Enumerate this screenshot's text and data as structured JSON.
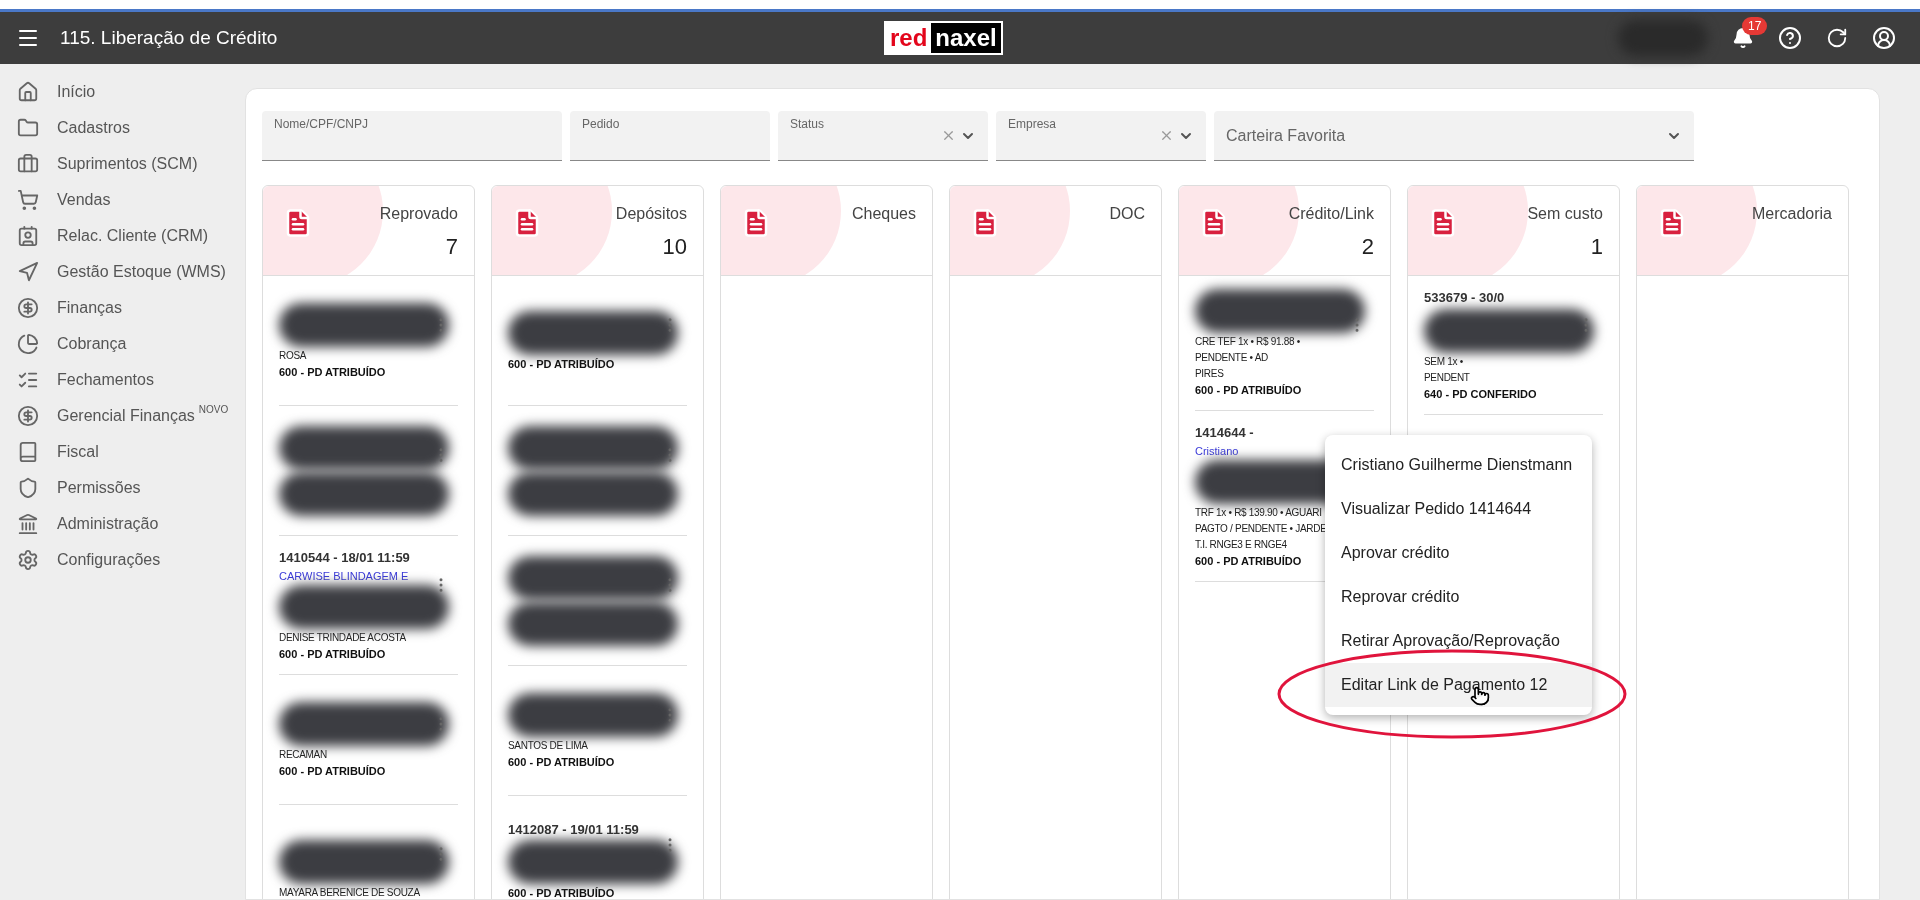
{
  "header": {
    "title": "115. Liberação de Crédito",
    "logo": {
      "left": "red",
      "right": "naxel"
    },
    "notifications": "17"
  },
  "sidebar": {
    "items": [
      {
        "label": "Início"
      },
      {
        "label": "Cadastros"
      },
      {
        "label": "Suprimentos (SCM)"
      },
      {
        "label": "Vendas"
      },
      {
        "label": "Relac. Cliente (CRM)"
      },
      {
        "label": "Gestão Estoque (WMS)"
      },
      {
        "label": "Finanças"
      },
      {
        "label": "Cobrança"
      },
      {
        "label": "Fechamentos"
      },
      {
        "label": "Gerencial Finanças",
        "badge": "NOVO"
      },
      {
        "label": "Fiscal"
      },
      {
        "label": "Permissões"
      },
      {
        "label": "Administração"
      },
      {
        "label": "Configurações"
      }
    ]
  },
  "filters": [
    {
      "kind": "text",
      "label": "Nome/CPF/CNPJ"
    },
    {
      "kind": "text",
      "label": "Pedido"
    },
    {
      "kind": "select",
      "label": "Status",
      "clearable": true
    },
    {
      "kind": "select",
      "label": "Empresa",
      "clearable": true
    },
    {
      "kind": "placeholder",
      "label": "Carteira Favorita"
    }
  ],
  "columns": [
    {
      "title": "Reprovado",
      "count": "7",
      "cards": [
        [
          {
            "kind": "blob"
          },
          {
            "kind": "text",
            "text": "ROSA"
          },
          {
            "kind": "status",
            "text": "600 - PD ATRIBUÍDO"
          }
        ],
        [
          {
            "kind": "blob"
          },
          {
            "kind": "blob"
          }
        ],
        [
          {
            "kind": "title",
            "text": "1410544 - 18/01 11:59"
          },
          {
            "kind": "client",
            "text": "CARWISE BLINDAGEM E"
          },
          {
            "kind": "blob"
          },
          {
            "kind": "text",
            "text": "DENISE TRINDADE ACOSTA"
          },
          {
            "kind": "status",
            "text": "600 - PD ATRIBUÍDO"
          }
        ],
        [
          {
            "kind": "blob"
          },
          {
            "kind": "text",
            "text": "RECAMAN"
          },
          {
            "kind": "status",
            "text": "600 - PD ATRIBUÍDO"
          }
        ],
        [
          {
            "kind": "blob"
          },
          {
            "kind": "text",
            "text": "MAYARA BERENICE DE SOUZA"
          }
        ]
      ]
    },
    {
      "title": "Depósitos",
      "count": "10",
      "cards": [
        [
          {
            "kind": "blob"
          },
          {
            "kind": "status",
            "text": "600 - PD ATRIBUÍDO"
          }
        ],
        [
          {
            "kind": "blob"
          },
          {
            "kind": "blob"
          }
        ],
        [
          {
            "kind": "blob"
          },
          {
            "kind": "blob"
          }
        ],
        [
          {
            "kind": "blob"
          },
          {
            "kind": "text",
            "text": "SANTOS DE LIMA"
          },
          {
            "kind": "status",
            "text": "600 - PD ATRIBUÍDO"
          }
        ],
        [
          {
            "kind": "title",
            "text": "1412087 - 19/01 11:59"
          },
          {
            "kind": "blob"
          },
          {
            "kind": "status",
            "text": "600 - PD ATRIBUÍDO"
          }
        ]
      ]
    },
    {
      "title": "Cheques"
    },
    {
      "title": "DOC"
    },
    {
      "title": "Crédito/Link",
      "count": "2",
      "cards": [
        [
          {
            "kind": "blob"
          },
          {
            "kind": "text",
            "text": "CRE TEF 1x • R$ 91.88 •"
          },
          {
            "kind": "text",
            "text": "PENDENTE • AD"
          },
          {
            "kind": "text",
            "text": "PIRES"
          },
          {
            "kind": "status",
            "text": "600 - PD ATRIBUÍDO"
          }
        ],
        [
          {
            "kind": "title",
            "text": "1414644 -"
          },
          {
            "kind": "client",
            "text": "Cristiano"
          },
          {
            "kind": "blob"
          },
          {
            "kind": "text",
            "text": "TRF 1x • R$ 139.90 • AGUARI"
          },
          {
            "kind": "text",
            "text": "PAGTO / PENDENTE • JARDE"
          },
          {
            "kind": "text",
            "text": "T.I. RNGE3 E RNGE4"
          },
          {
            "kind": "status",
            "text": "600 - PD ATRIBUÍDO"
          }
        ]
      ]
    },
    {
      "title": "Sem custo",
      "count": "1",
      "cards": [
        [
          {
            "kind": "title",
            "text": "533679 - 30/0"
          },
          {
            "kind": "blob"
          },
          {
            "kind": "text",
            "text": "SEM 1x •"
          },
          {
            "kind": "text",
            "text": "PENDENT"
          },
          {
            "kind": "status",
            "text": "640 - PD CONFERIDO"
          }
        ]
      ]
    },
    {
      "title": "Mercadoria"
    }
  ],
  "menu": {
    "items": [
      {
        "label": "Cristiano Guilherme Dienstmann",
        "selected": false
      },
      {
        "label": "Visualizar Pedido 1414644",
        "selected": false
      },
      {
        "label": "Aprovar crédito",
        "selected": false
      },
      {
        "label": "Reprovar crédito",
        "selected": false
      },
      {
        "label": "Retirar Aprovação/Reprovação",
        "selected": false
      },
      {
        "label": "Editar Link de Pagamento 12",
        "selected": true
      }
    ]
  }
}
